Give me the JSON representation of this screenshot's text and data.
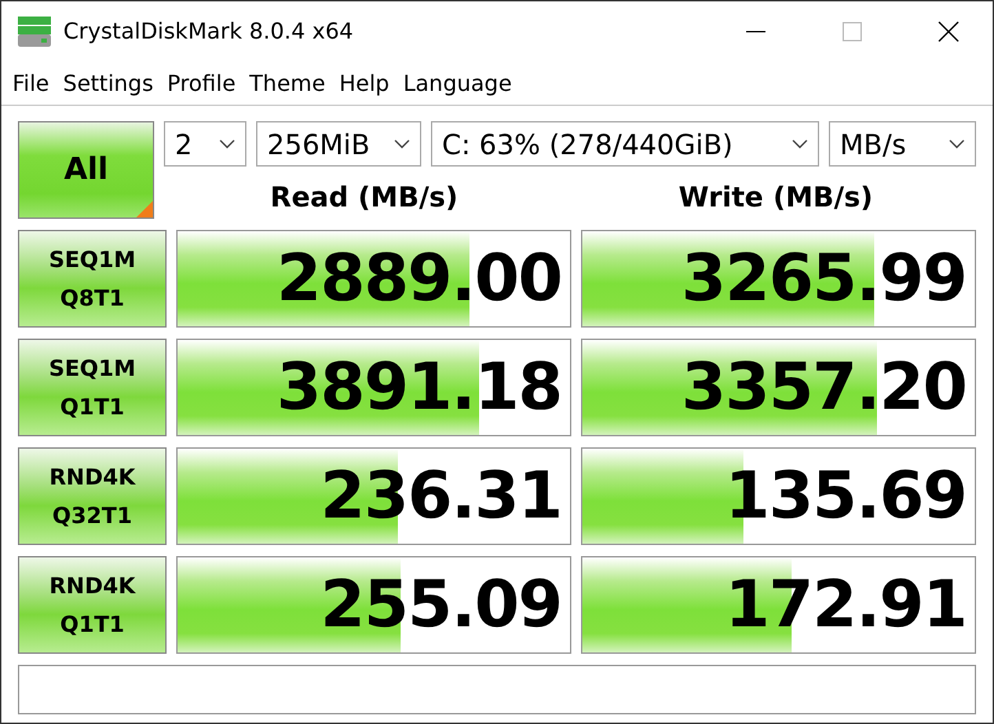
{
  "window": {
    "title": "CrystalDiskMark 8.0.4 x64"
  },
  "menu": [
    "File",
    "Settings",
    "Profile",
    "Theme",
    "Help",
    "Language"
  ],
  "all_button": {
    "label": "All"
  },
  "selectors": [
    {
      "value": "2"
    },
    {
      "value": "256MiB"
    },
    {
      "value": "C: 63% (278/440GiB)"
    },
    {
      "value": "MB/s"
    }
  ],
  "headers": [
    "Read (MB/s)",
    "Write (MB/s)"
  ],
  "tests": [
    {
      "name": "SEQ1M",
      "params": "Q8T1",
      "read": {
        "value": "2889.00",
        "level": 0.745
      },
      "write": {
        "value": "3265.99",
        "level": 0.745
      }
    },
    {
      "name": "SEQ1M",
      "params": "Q1T1",
      "read": {
        "value": "3891.18",
        "level": 0.77
      },
      "write": {
        "value": "3357.20",
        "level": 0.75
      }
    },
    {
      "name": "RND4K",
      "params": "Q32T1",
      "read": {
        "value": "236.31",
        "level": 0.56
      },
      "write": {
        "value": "135.69",
        "level": 0.41
      }
    },
    {
      "name": "RND4K",
      "params": "Q1T1",
      "read": {
        "value": "255.09",
        "level": 0.57
      },
      "write": {
        "value": "172.91",
        "level": 0.535
      }
    }
  ]
}
